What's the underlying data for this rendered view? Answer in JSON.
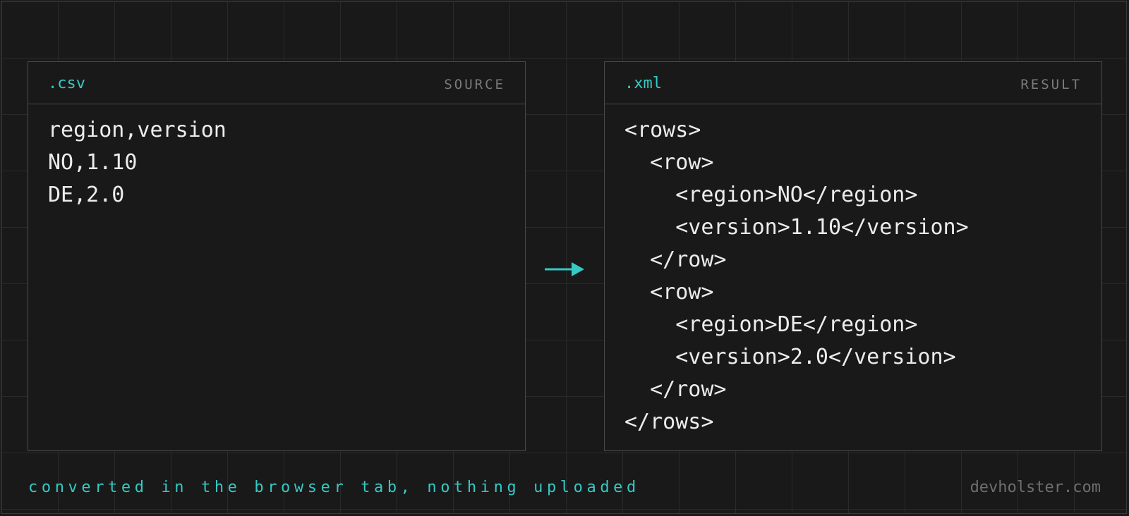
{
  "source_panel": {
    "extension": ".csv",
    "role": "SOURCE",
    "lines": [
      "region,version",
      "NO,1.10",
      "DE,2.0"
    ]
  },
  "result_panel": {
    "extension": ".xml",
    "role": "RESULT",
    "lines": [
      "<rows>",
      "  <row>",
      "    <region>NO</region>",
      "    <version>1.10</version>",
      "  </row>",
      "  <row>",
      "    <region>DE</region>",
      "    <version>2.0</version>",
      "  </row>",
      "</rows>"
    ]
  },
  "footer": {
    "note": "converted in the browser tab, nothing uploaded",
    "brand": "devholster.com"
  },
  "colors": {
    "accent": "#35c9c4",
    "background": "#191919",
    "text": "#ececec"
  },
  "icons": {
    "conversion_arrow": "arrow-right-icon"
  }
}
